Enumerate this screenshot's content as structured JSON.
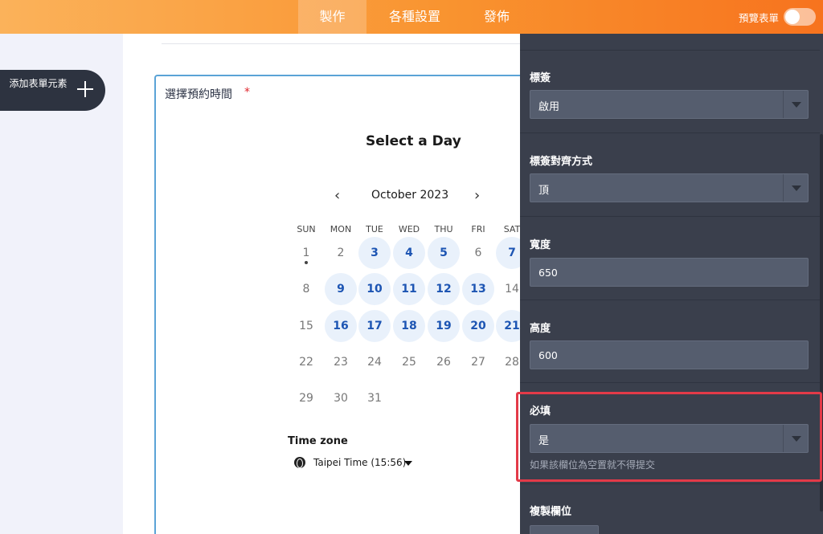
{
  "topbar": {
    "tabs": [
      {
        "label": "製作",
        "active": true
      },
      {
        "label": "各種設置",
        "active": false
      },
      {
        "label": "發佈",
        "active": false
      }
    ],
    "preview_label": "預覽表單",
    "preview_toggle_on": false
  },
  "sidebar": {
    "add_element_label": "添加表單元素",
    "add_icon": "plus-icon"
  },
  "form_field": {
    "label": "選擇預約時間",
    "required_marker": "*",
    "calendar": {
      "heading": "Select a Day",
      "month": "October 2023",
      "weekdays": [
        "SUN",
        "MON",
        "TUE",
        "WED",
        "THU",
        "FRI",
        "SAT"
      ],
      "weeks": [
        [
          "1",
          "2",
          "3",
          "4",
          "5",
          "6",
          "7"
        ],
        [
          "8",
          "9",
          "10",
          "11",
          "12",
          "13",
          "14"
        ],
        [
          "15",
          "16",
          "17",
          "18",
          "19",
          "20",
          "21"
        ],
        [
          "22",
          "23",
          "24",
          "25",
          "26",
          "27",
          "28"
        ],
        [
          "29",
          "30",
          "31"
        ]
      ],
      "available_days": [
        "3",
        "4",
        "5",
        "7",
        "9",
        "10",
        "11",
        "12",
        "13",
        "16",
        "17",
        "18",
        "19",
        "20",
        "21"
      ],
      "today": "1"
    },
    "timezone": {
      "title": "Time zone",
      "value": "Taipei Time (15:56)"
    }
  },
  "properties": {
    "label_section": {
      "title": "標簽",
      "value": "啟用"
    },
    "align_section": {
      "title": "標簽對齊方式",
      "value": "頂"
    },
    "width_section": {
      "title": "寬度",
      "value": "650"
    },
    "height_section": {
      "title": "高度",
      "value": "600"
    },
    "required_section": {
      "title": "必填",
      "value": "是",
      "hint": "如果該欄位為空置就不得提交"
    },
    "duplicate_section": {
      "title": "複製欄位"
    }
  },
  "colors": {
    "accent_orange": "#f7731e",
    "panel_bg": "#3a3f4c",
    "available_day": "#1d55b3",
    "highlight_red": "#e33a48"
  }
}
